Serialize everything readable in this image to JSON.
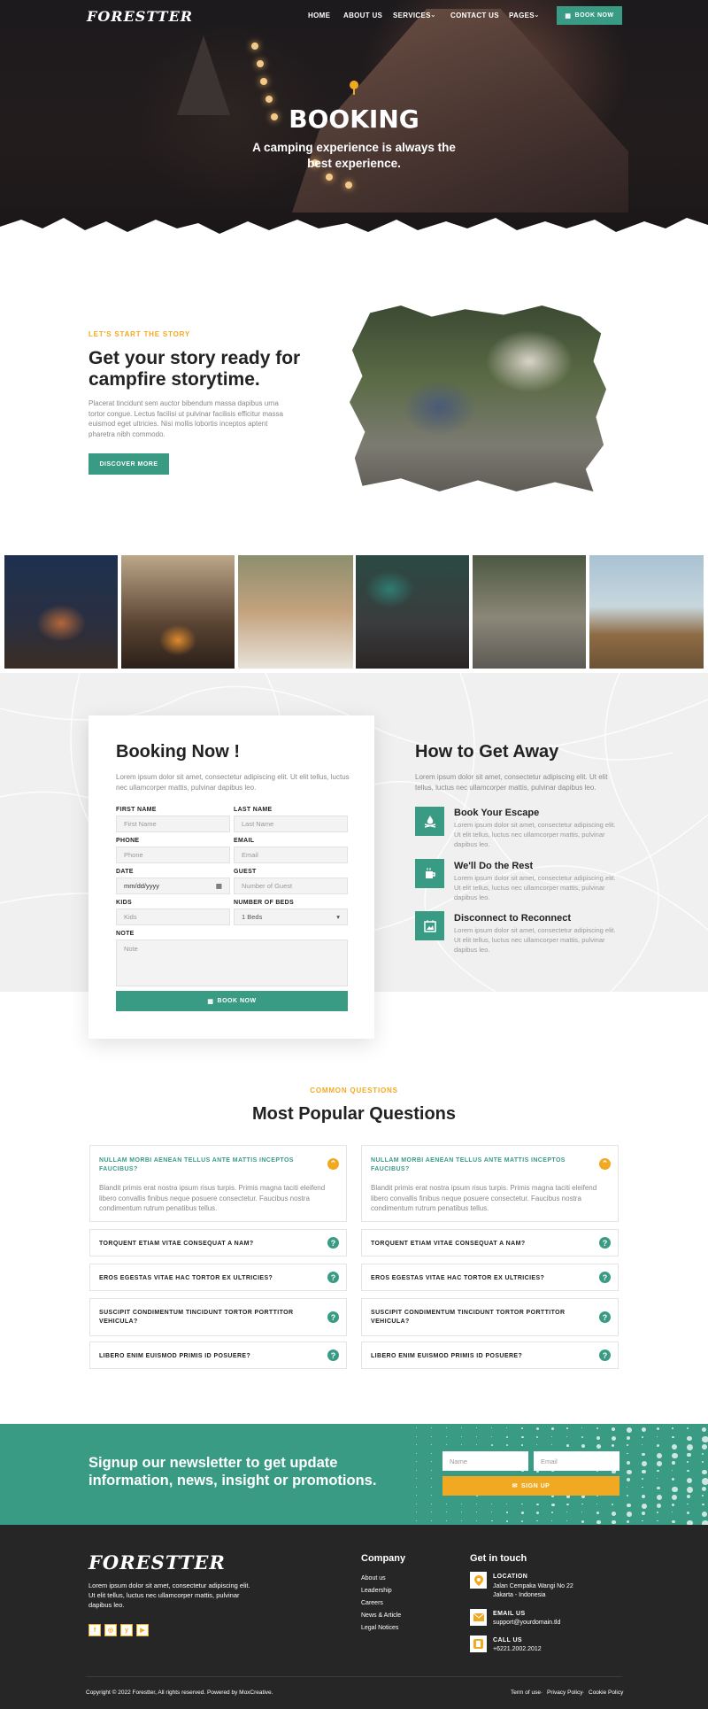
{
  "nav": {
    "logo": "FORESTTER",
    "items": [
      "HOME",
      "ABOUT US",
      "SERVICES",
      "CONTACT US",
      "PAGES"
    ],
    "book_button": "BOOK NOW"
  },
  "hero": {
    "title": "BOOKING",
    "subtitle": "A camping experience is always the best experience."
  },
  "story": {
    "eyebrow": "LET'S START THE STORY",
    "heading": "Get your story ready for campfire storytime.",
    "body": "Placerat tincidunt sem auctor bibendum massa dapibus urna tortor congue. Lectus facilisi ut pulvinar facilisis efficitur massa euismod eget ultricies. Nisi mollis lobortis inceptos aptent pharetra nibh commodo.",
    "button": "DISCOVER MORE"
  },
  "booking": {
    "title": "Booking Now !",
    "intro": "Lorem ipsum dolor sit amet, consectetur adipiscing elit. Ut elit tellus, luctus nec ullamcorper mattis, pulvinar dapibus leo.",
    "fields": {
      "first_name_label": "FIRST NAME",
      "first_name_ph": "First Name",
      "last_name_label": "LAST NAME",
      "last_name_ph": "Last Name",
      "phone_label": "PHONE",
      "phone_ph": "Phone",
      "email_label": "EMAIL",
      "email_ph": "Email",
      "date_label": "DATE",
      "date_ph": "mm/dd/yyyy",
      "guest_label": "GUEST",
      "guest_ph": "Number of Guest",
      "kids_label": "KIDS",
      "kids_ph": "Kids",
      "beds_label": "NUMBER OF BEDS",
      "beds_value": "1 Beds",
      "note_label": "NOTE",
      "note_ph": "Note"
    },
    "submit": "BOOK NOW"
  },
  "getaway": {
    "title": "How to Get Away",
    "intro": "Lorem ipsum dolor sit amet, consectetur adipiscing elit. Ut elit tellus, luctus nec ullamcorper mattis, pulvinar dapibus leo.",
    "features": [
      {
        "title": "Book Your Escape",
        "text": "Lorem ipsum dolor sit amet, consectetur adipiscing elit. Ut elit tellus, luctus nec ullamcorper mattis, pulvinar dapibus leo.",
        "icon": "campfire-icon"
      },
      {
        "title": "We'll Do the Rest",
        "text": "Lorem ipsum dolor sit amet, consectetur adipiscing elit. Ut elit tellus, luctus nec ullamcorper mattis, pulvinar dapibus leo.",
        "icon": "coffee-mug-icon"
      },
      {
        "title": "Disconnect to Reconnect",
        "text": "Lorem ipsum dolor sit amet, consectetur adipiscing elit. Ut elit tellus, luctus nec ullamcorper mattis, pulvinar dapibus leo.",
        "icon": "picture-frame-icon"
      }
    ]
  },
  "faq": {
    "eyebrow": "COMMON QUESTIONS",
    "title": "Most Popular Questions",
    "open_question": "NULLAM MORBI AENEAN TELLUS ANTE MATTIS INCEPTOS FAUCIBUS?",
    "open_answer": "Blandit primis erat nostra ipsum risus turpis. Primis magna taciti eleifend libero convallis finibus neque posuere consectetur. Faucibus nostra condimentum rutrum penatibus tellus.",
    "questions": [
      "TORQUENT ETIAM VITAE CONSEQUAT A NAM?",
      "EROS EGESTAS VITAE HAC TORTOR EX ULTRICIES?",
      "SUSCIPIT CONDIMENTUM TINCIDUNT TORTOR PORTTITOR VEHICULA?",
      "LIBERO ENIM EUISMOD PRIMIS ID POSUERE?"
    ]
  },
  "newsletter": {
    "heading": "Signup our newsletter to get update information, news, insight or promotions.",
    "name_ph": "Name",
    "email_ph": "Email",
    "button": "SIGN UP"
  },
  "footer": {
    "logo": "FORESTTER",
    "about": "Lorem ipsum dolor sit amet, consectetur adipiscing elit. Ut elit tellus, luctus nec ullamcorper mattis, pulvinar dapibus leo.",
    "company_title": "Company",
    "company_links": [
      "About us",
      "Leadership",
      "Careers",
      "News & Article",
      "Legal Notices"
    ],
    "contact_title": "Get in touch",
    "location_label": "LOCATION",
    "location_value": "Jalan Cempaka Wangi No 22 Jakarta - Indonesia",
    "email_label": "EMAIL US",
    "email_value": "support@yourdomain.tld",
    "call_label": "CALL US",
    "call_value": "+6221.2002.2012",
    "copyright": "Copyright © 2022 Forestter, All rights reserved. Powered by MoxCreative.",
    "legal_links": [
      "Term of use",
      "Privacy Policy",
      "Cookie Policy"
    ],
    "social": [
      "f",
      "◎",
      "y",
      "▶"
    ]
  },
  "colors": {
    "accent": "#3a9b85",
    "brand_orange": "#f2a922",
    "footer_bg": "#262626"
  }
}
